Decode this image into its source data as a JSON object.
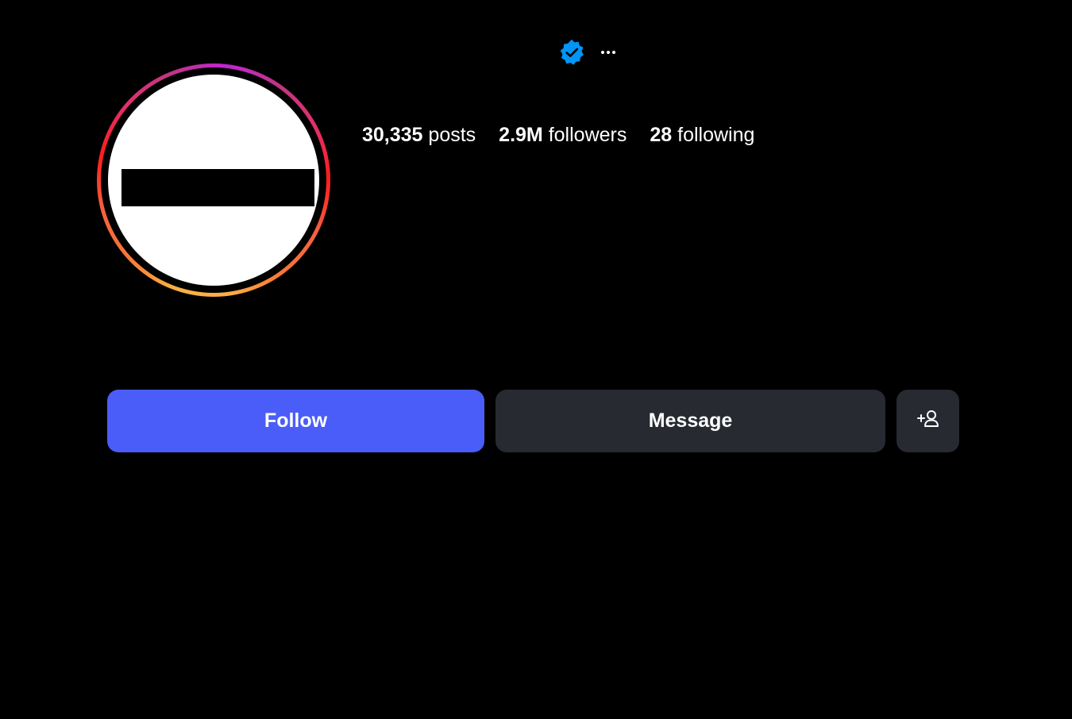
{
  "profile": {
    "verified_icon": "verified-badge-icon",
    "more_icon": "more-options-icon",
    "avatar_ring_colors": [
      "#fcaf45",
      "#f77737",
      "#fd1d1d",
      "#e1306c",
      "#c026d3"
    ]
  },
  "stats": {
    "posts_count": "30,335",
    "posts_label": " posts",
    "followers_count": "2.9M",
    "followers_label": " followers",
    "following_count": "28",
    "following_label": " following"
  },
  "actions": {
    "follow_label": "Follow",
    "message_label": "Message",
    "add_user_icon": "add-user-icon",
    "follow_color": "#4a5df9",
    "secondary_color": "#272a31"
  }
}
